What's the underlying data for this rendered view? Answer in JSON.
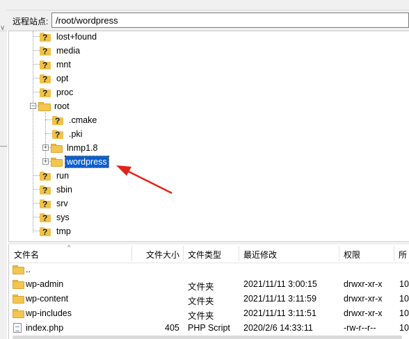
{
  "address_bar": {
    "label": "远程站点:",
    "path": "/root/wordpress"
  },
  "tree": {
    "top_items": [
      {
        "name": "lost+found",
        "icon": "question-folder-icon"
      },
      {
        "name": "media",
        "icon": "question-folder-icon"
      },
      {
        "name": "mnt",
        "icon": "question-folder-icon"
      },
      {
        "name": "opt",
        "icon": "question-folder-icon"
      },
      {
        "name": "proc",
        "icon": "question-folder-icon"
      }
    ],
    "root": {
      "name": "root",
      "expanded": true,
      "children": [
        {
          "name": ".cmake",
          "icon": "question-folder-icon"
        },
        {
          "name": ".pki",
          "icon": "question-folder-icon"
        },
        {
          "name": "lnmp1.8",
          "icon": "folder-icon",
          "collapsed": true
        },
        {
          "name": "wordpress",
          "icon": "folder-icon",
          "collapsed": true,
          "selected": true
        }
      ]
    },
    "bottom_items": [
      {
        "name": "run",
        "icon": "question-folder-icon"
      },
      {
        "name": "sbin",
        "icon": "question-folder-icon"
      },
      {
        "name": "srv",
        "icon": "question-folder-icon"
      },
      {
        "name": "sys",
        "icon": "question-folder-icon"
      },
      {
        "name": "tmp",
        "icon": "question-folder-icon"
      }
    ],
    "expander_collapsed": "+",
    "expander_expanded": "−"
  },
  "annotation": {
    "type": "red-arrow",
    "color": "#e0231c"
  },
  "file_list": {
    "columns": [
      "文件名",
      "文件大小",
      "文件类型",
      "最近修改",
      "权限",
      "所"
    ],
    "sort_indicator": "^",
    "rows": [
      {
        "name": "..",
        "size": "",
        "type": "",
        "modified": "",
        "perms": "",
        "owner": "",
        "icon": "folder-icon"
      },
      {
        "name": "wp-admin",
        "size": "",
        "type": "文件夹",
        "modified": "2021/11/11 3:00:15",
        "perms": "drwxr-xr-x",
        "owner": "10",
        "icon": "folder-icon"
      },
      {
        "name": "wp-content",
        "size": "",
        "type": "文件夹",
        "modified": "2021/11/11 3:11:59",
        "perms": "drwxr-xr-x",
        "owner": "10",
        "icon": "folder-icon"
      },
      {
        "name": "wp-includes",
        "size": "",
        "type": "文件夹",
        "modified": "2021/11/11 3:11:51",
        "perms": "drwxr-xr-x",
        "owner": "10",
        "icon": "folder-icon"
      },
      {
        "name": "index.php",
        "size": "405",
        "type": "PHP Script",
        "modified": "2020/2/6 14:33:11",
        "perms": "-rw-r--r--",
        "owner": "10",
        "icon": "php-file-icon"
      }
    ]
  },
  "left_pane": {
    "chevron": "∨"
  },
  "colors": {
    "selection": "#0a5fd0",
    "folder": "#f3c650",
    "panel_bg": "#f0f0f0",
    "arrow": "#e0231c"
  }
}
